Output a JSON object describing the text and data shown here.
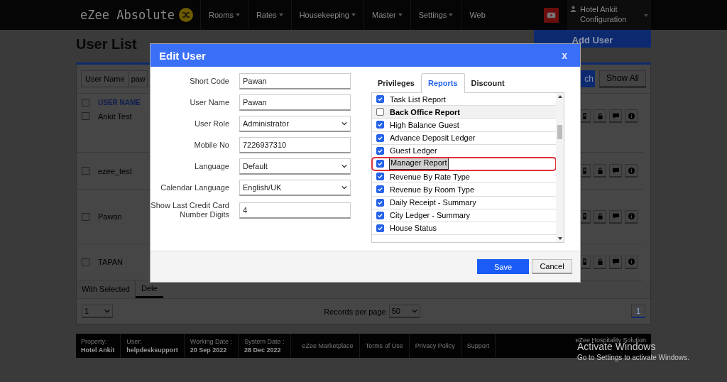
{
  "nav": {
    "logo": "eZee Absolute",
    "menus": [
      {
        "label": "Rooms",
        "dropdown": true
      },
      {
        "label": "Rates",
        "dropdown": true
      },
      {
        "label": "Housekeeping",
        "dropdown": true
      },
      {
        "label": "Master",
        "dropdown": true
      },
      {
        "label": "Settings",
        "dropdown": true
      },
      {
        "label": "Web",
        "dropdown": false
      }
    ],
    "user": {
      "name": "Hotel Ankit",
      "sub": "Configuration"
    }
  },
  "page": {
    "title": "User List",
    "add_button": "Add User",
    "search_label": "User Name",
    "search_value": "paw",
    "search_button": "ch",
    "show_all": "Show All",
    "column": "USER NAME",
    "column_checked": false,
    "rows": [
      {
        "name": "Ankit Test",
        "checked": false
      },
      {
        "name": "ezee_test",
        "checked": false
      },
      {
        "name": "Pawan",
        "checked": false
      },
      {
        "name": "TAPAN",
        "checked": false
      }
    ],
    "bulk_label": "With Selected",
    "bulk_tab": "Dele",
    "page_select": "1",
    "records_label": "Records per page",
    "records_select": "50",
    "current_page": "1"
  },
  "footer": {
    "items": [
      {
        "label": "Property:",
        "value": "Hotel Ankit"
      },
      {
        "label": "User:",
        "value": "helpdesksupport"
      },
      {
        "label": "Working Date :",
        "value": "20 Sep 2022"
      },
      {
        "label": "System Date :",
        "value": "28 Dec 2022"
      }
    ],
    "links": [
      "eZee Marketplace",
      "Terms of Use",
      "Privacy Policy",
      "Support"
    ],
    "brand": "eZee Hospitality Solution"
  },
  "modal": {
    "title": "Edit User",
    "close": "x",
    "fields": [
      {
        "label": "Short Code",
        "kind": "text",
        "value": "Pawan"
      },
      {
        "label": "User Name",
        "kind": "text",
        "value": "Pawan"
      },
      {
        "label": "User Role",
        "kind": "select",
        "value": "Administrator"
      },
      {
        "label": "Mobile No",
        "kind": "text",
        "value": "7226937310"
      },
      {
        "label": "Language",
        "kind": "select",
        "value": "Default"
      },
      {
        "label": "Calendar Language",
        "kind": "select",
        "value": "English/UK"
      },
      {
        "label": "Show Last Credit Card Number Digits",
        "kind": "text",
        "value": "4"
      }
    ],
    "tabs": [
      {
        "label": "Privileges",
        "selected": false
      },
      {
        "label": "Reports",
        "selected": true
      },
      {
        "label": "Discount",
        "selected": false
      }
    ],
    "reports": [
      {
        "label": "Task List Report",
        "kind": "item",
        "checked": true,
        "highlighted": false
      },
      {
        "label": "Back Office Report",
        "kind": "group",
        "checked": false,
        "highlighted": false
      },
      {
        "label": "High Balance Guest",
        "kind": "item",
        "checked": true,
        "highlighted": false
      },
      {
        "label": "Advance Deposit Ledger",
        "kind": "item",
        "checked": true,
        "highlighted": false
      },
      {
        "label": "Guest Ledger",
        "kind": "item",
        "checked": true,
        "highlighted": false
      },
      {
        "label": "Manager Report",
        "kind": "item",
        "checked": true,
        "highlighted": true
      },
      {
        "label": "Revenue By Rate Type",
        "kind": "item",
        "checked": true,
        "highlighted": false
      },
      {
        "label": "Revenue By Room Type",
        "kind": "item",
        "checked": true,
        "highlighted": false
      },
      {
        "label": "Daily Receipt - Summary",
        "kind": "item",
        "checked": true,
        "highlighted": false
      },
      {
        "label": "City Ledger - Summary",
        "kind": "item",
        "checked": true,
        "highlighted": false
      },
      {
        "label": "House Status",
        "kind": "item",
        "checked": true,
        "highlighted": false
      }
    ],
    "save": "Save",
    "cancel": "Cancel"
  },
  "activation": {
    "title": "Activate Windows",
    "subtitle": "Go to Settings to activate Windows."
  }
}
